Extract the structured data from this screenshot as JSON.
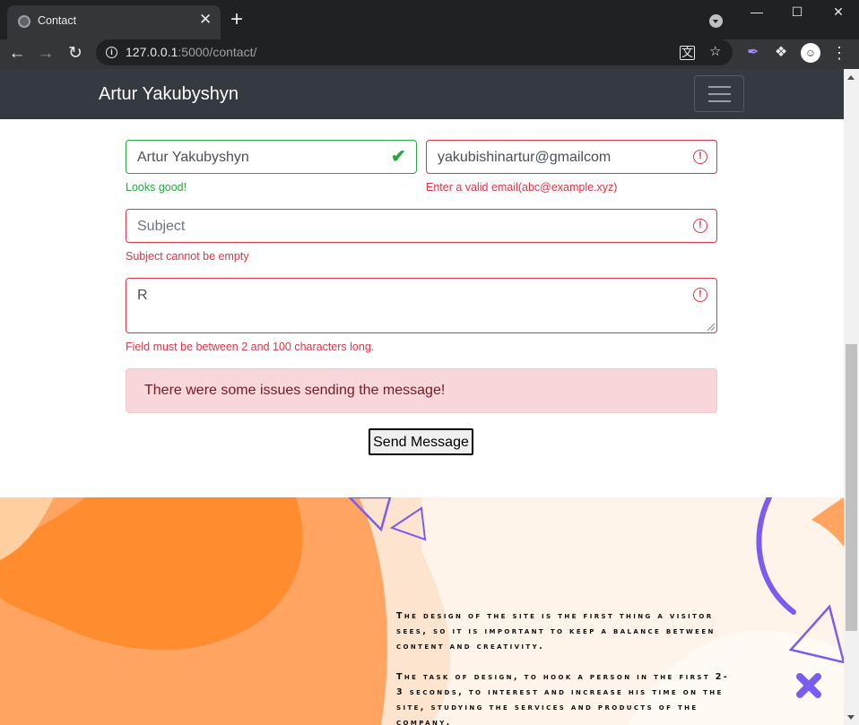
{
  "browser": {
    "tab_title": "Contact",
    "tab_close": "✕",
    "new_tab": "+",
    "url_host": "127.0.0.1",
    "url_path": ":5000/contact/",
    "window_controls": {
      "minimize": "—",
      "maximize": "☐",
      "close": "✕"
    }
  },
  "navbar": {
    "brand": "Artur Yakubyshyn"
  },
  "form": {
    "name": {
      "value": "Artur Yakubyshyn",
      "feedback": "Looks good!",
      "state": "valid"
    },
    "email": {
      "value": "yakubishinartur@gmailcom",
      "feedback": "Enter a valid email(abc@example.xyz)",
      "state": "invalid"
    },
    "subject": {
      "value": "",
      "placeholder": "Subject",
      "feedback": "Subject cannot be empty",
      "state": "invalid"
    },
    "message": {
      "value": "R",
      "feedback": "Field must be between 2 and 100 characters long.",
      "state": "invalid"
    },
    "alert": "There were some issues sending the message!",
    "submit_label": "Send Message"
  },
  "footer": {
    "paragraphs": [
      "The design of the site is the first thing a visitor sees, so it is important to keep a balance between content and creativity.",
      "The task of design, to hook a person in the first 2-3 seconds, to interest and increase his time on the site, studying the services and products of the company."
    ]
  },
  "icons": {
    "favicon": "globe-icon",
    "back": "arrow-left-icon",
    "forward": "arrow-right-icon",
    "reload": "reload-icon",
    "site_info": "info-icon",
    "translate": "translate-icon",
    "bookmark": "star-icon",
    "extension_feather": "feather-icon",
    "extensions": "puzzle-icon",
    "profile": "avatar-icon",
    "menu": "kebab-menu-icon",
    "valid": "check-icon",
    "invalid": "exclamation-circle-icon"
  },
  "colors": {
    "navbar": "#343a40",
    "valid": "#28a745",
    "invalid": "#dc3545",
    "alert_bg": "#f8d7da",
    "alert_text": "#721c24",
    "footer_orange": "#ff8c2f",
    "footer_light": "#ffa561",
    "footer_purple": "#7b5cf0"
  }
}
